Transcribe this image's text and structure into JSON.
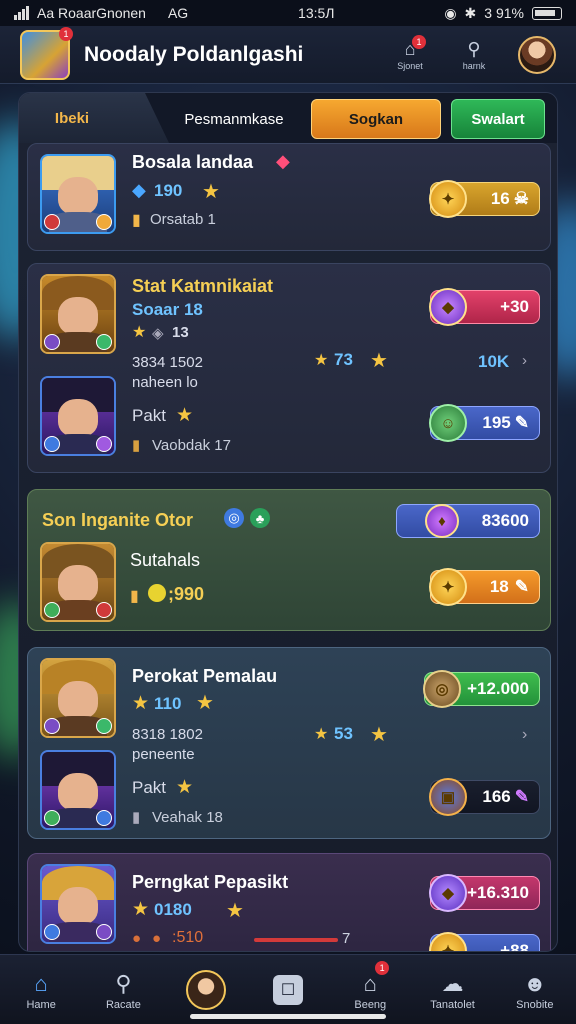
{
  "status_bar": {
    "carrier": "Aa RoaarGnonen",
    "network": "AG",
    "time": "13:5Л",
    "battery": "3 91%"
  },
  "header": {
    "title": "Noodaly Poldanlgashi",
    "logo_badge": "1",
    "btn1_label": "Sjonet",
    "btn1_badge": "1",
    "btn2_label": "harnk"
  },
  "tabs": [
    {
      "label": "Ibeki"
    },
    {
      "label": "Pesmanmkase"
    },
    {
      "label": "Sogkan"
    },
    {
      "label": "Swalart"
    }
  ],
  "cards": [
    {
      "name": "Bosala landaa",
      "stat": "190",
      "sub": "Orsatab 1",
      "pill": "16"
    },
    {
      "name": "Stat Katmnikaiat",
      "title2": "Soaar 18",
      "stat": "13",
      "line1": "3834 1502",
      "line2": "naheen lo",
      "mid": "73",
      "pill1": "+30",
      "right": "10K",
      "name2": "Pakt",
      "sub2": "Vaobdak 17",
      "pill2": "195"
    },
    {
      "name": "Son Inganite Otor",
      "pill_top": "83600",
      "label": "Sutahals",
      "stat": ";990",
      "pill": "18"
    },
    {
      "name": "Perokat Pemalau",
      "stat": "110",
      "line1": "8318 1802",
      "line2": "peneente",
      "mid": "53",
      "pill1": "+12.000",
      "name2": "Pakt",
      "sub2": "Veahak 18",
      "pill2": "166"
    },
    {
      "name": "Perngkat Pepasikt",
      "stat": "0180",
      "bottom": ":510",
      "pill1": "+16.310",
      "pill2": "+88",
      "mark": "7"
    }
  ],
  "bottom_nav": [
    {
      "label": "Hame"
    },
    {
      "label": "Racate"
    },
    {
      "label": ""
    },
    {
      "label": ""
    },
    {
      "label": "Beeng",
      "badge": "1"
    },
    {
      "label": "Tanatolet"
    },
    {
      "label": "Snobite"
    }
  ]
}
